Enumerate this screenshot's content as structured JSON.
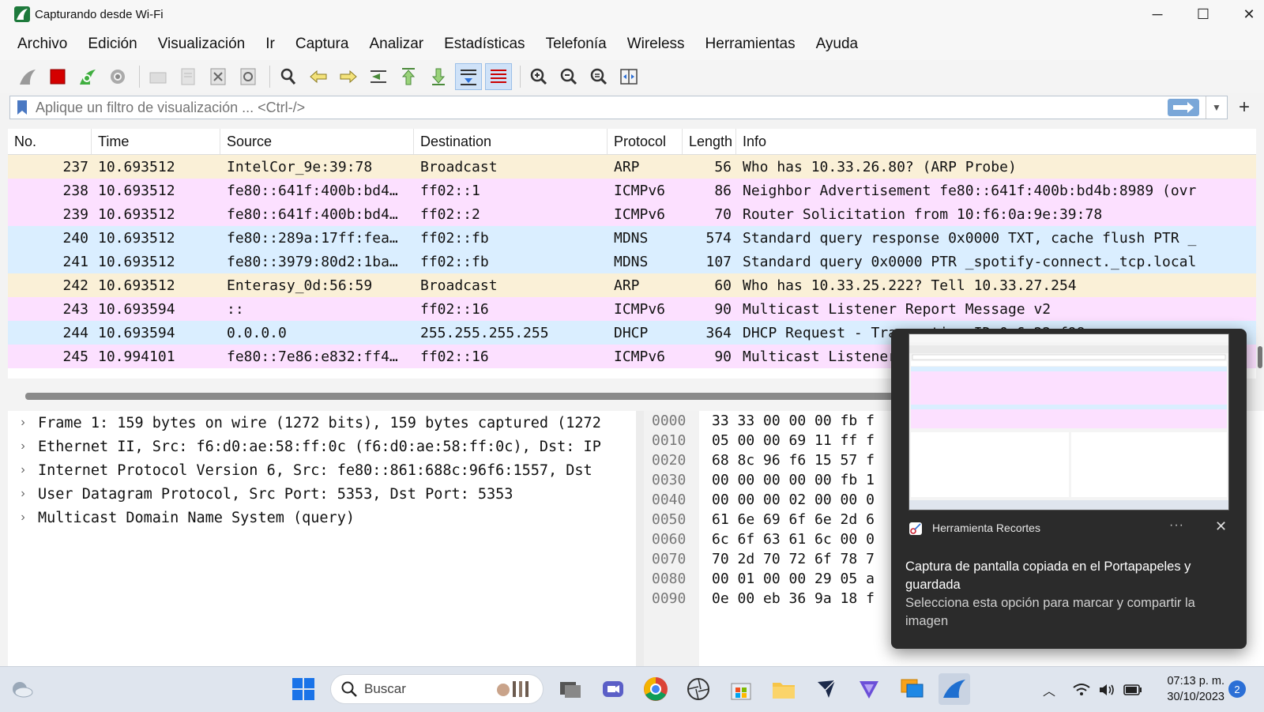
{
  "window": {
    "title": "Capturando desde Wi-Fi",
    "controls": {
      "minimize": "─",
      "maximize": "☐",
      "close": "✕"
    }
  },
  "menu": [
    "Archivo",
    "Edición",
    "Visualización",
    "Ir",
    "Captura",
    "Analizar",
    "Estadísticas",
    "Telefonía",
    "Wireless",
    "Herramientas",
    "Ayuda"
  ],
  "filter": {
    "placeholder": "Aplique un filtro de visualización ... <Ctrl-/>",
    "add_label": "+"
  },
  "packet_list": {
    "columns": [
      "No.",
      "Time",
      "Source",
      "Destination",
      "Protocol",
      "Length",
      "Info"
    ],
    "rows": [
      {
        "no": "237",
        "time": "10.693512",
        "source": "IntelCor_9e:39:78",
        "destination": "Broadcast",
        "protocol": "ARP",
        "length": "56",
        "info": "Who has 10.33.26.80? (ARP Probe)",
        "color": "#faf0d7"
      },
      {
        "no": "238",
        "time": "10.693512",
        "source": "fe80::641f:400b:bd4…",
        "destination": "ff02::1",
        "protocol": "ICMPv6",
        "length": "86",
        "info": "Neighbor Advertisement fe80::641f:400b:bd4b:8989 (ovr",
        "color": "#fce0ff"
      },
      {
        "no": "239",
        "time": "10.693512",
        "source": "fe80::641f:400b:bd4…",
        "destination": "ff02::2",
        "protocol": "ICMPv6",
        "length": "70",
        "info": "Router Solicitation from 10:f6:0a:9e:39:78",
        "color": "#fce0ff"
      },
      {
        "no": "240",
        "time": "10.693512",
        "source": "fe80::289a:17ff:fea…",
        "destination": "ff02::fb",
        "protocol": "MDNS",
        "length": "574",
        "info": "Standard query response 0x0000 TXT, cache flush PTR _",
        "color": "#daeeff"
      },
      {
        "no": "241",
        "time": "10.693512",
        "source": "fe80::3979:80d2:1ba…",
        "destination": "ff02::fb",
        "protocol": "MDNS",
        "length": "107",
        "info": "Standard query 0x0000 PTR _spotify-connect._tcp.local",
        "color": "#daeeff"
      },
      {
        "no": "242",
        "time": "10.693512",
        "source": "Enterasy_0d:56:59",
        "destination": "Broadcast",
        "protocol": "ARP",
        "length": "60",
        "info": "Who has 10.33.25.222? Tell 10.33.27.254",
        "color": "#faf0d7"
      },
      {
        "no": "243",
        "time": "10.693594",
        "source": "::",
        "destination": "ff02::16",
        "protocol": "ICMPv6",
        "length": "90",
        "info": "Multicast Listener Report Message v2",
        "color": "#fce0ff"
      },
      {
        "no": "244",
        "time": "10.693594",
        "source": "0.0.0.0",
        "destination": "255.255.255.255",
        "protocol": "DHCP",
        "length": "364",
        "info": "DHCP Request  - Transaction ID 0x6a22ef98",
        "color": "#daeeff"
      },
      {
        "no": "245",
        "time": "10.994101",
        "source": "fe80::7e86:e832:ff4…",
        "destination": "ff02::16",
        "protocol": "ICMPv6",
        "length": "90",
        "info": "Multicast Listener Report Message v2",
        "color": "#fce0ff"
      }
    ]
  },
  "details": [
    "Frame 1: 159 bytes on wire (1272 bits), 159 bytes captured (1272",
    "Ethernet II, Src: f6:d0:ae:58:ff:0c (f6:d0:ae:58:ff:0c), Dst: IP",
    "Internet Protocol Version 6, Src: fe80::861:688c:96f6:1557, Dst",
    "User Datagram Protocol, Src Port: 5353, Dst Port: 5353",
    "Multicast Domain Name System (query)"
  ],
  "bytes": [
    {
      "offset": "0000",
      "hex": "33 33 00 00 00 fb f"
    },
    {
      "offset": "0010",
      "hex": "05 00 00 69 11 ff f"
    },
    {
      "offset": "0020",
      "hex": "68 8c 96 f6 15 57 f"
    },
    {
      "offset": "0030",
      "hex": "00 00 00 00 00 fb 1"
    },
    {
      "offset": "0040",
      "hex": "00 00 00 02 00 00 0"
    },
    {
      "offset": "0050",
      "hex": "61 6e 69 6f 6e 2d 6"
    },
    {
      "offset": "0060",
      "hex": "6c 6f 63 61 6c 00 0"
    },
    {
      "offset": "0070",
      "hex": "70 2d 70 72 6f 78 7"
    },
    {
      "offset": "0080",
      "hex": "00 01 00 00 29 05 a"
    },
    {
      "offset": "0090",
      "hex": "0e 00 eb 36 9a 18 f"
    }
  ],
  "notification": {
    "app": "Herramienta Recortes",
    "more": "···",
    "close": "✕",
    "title": "Captura de pantalla copiada en el Portapapeles y guardada",
    "body": "Selecciona esta opción para marcar y compartir la imagen"
  },
  "taskbar": {
    "search_label": "Buscar",
    "time": "07:13 p. m.",
    "date": "30/10/2023",
    "notification_count": "2"
  }
}
